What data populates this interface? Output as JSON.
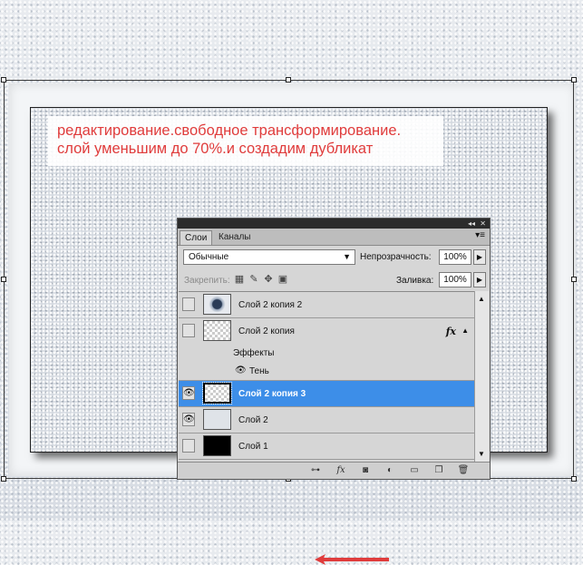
{
  "caption": {
    "line1": "редактирование.свободное трансформирование.",
    "line2": "слой уменьшим до 70%.и создадим дубликат"
  },
  "colors": {
    "caption_text": "#e03c3c",
    "selection": "#3d8ee8",
    "arrow": "#e03c3c"
  },
  "layers_panel": {
    "tabs": [
      "Слои",
      "Каналы"
    ],
    "blend_mode": "Обычные",
    "opacity_label": "Непрозрачность:",
    "opacity_value": "100%",
    "lock_label": "Закрепить:",
    "fill_label": "Заливка:",
    "fill_value": "100%",
    "layers": [
      {
        "name": "Слой 2 копия 2",
        "visible": false,
        "thumb": "emblem"
      },
      {
        "name": "Слой 2 копия",
        "visible": false,
        "thumb": "transparent",
        "fx": "fx"
      },
      {
        "name": "Слой 2 копия 3",
        "visible": true,
        "thumb": "transparent",
        "selected": true
      },
      {
        "name": "Слой 2",
        "visible": true,
        "thumb": "snow"
      },
      {
        "name": "Слой 1",
        "visible": false,
        "thumb": "black"
      }
    ],
    "effects_label": "Эффекты",
    "shadow_label": "Тень",
    "bottom_icons": [
      "link-icon",
      "fx-icon",
      "mask-icon",
      "adjustment-icon",
      "folder-icon",
      "new-layer-icon",
      "trash-icon"
    ]
  }
}
